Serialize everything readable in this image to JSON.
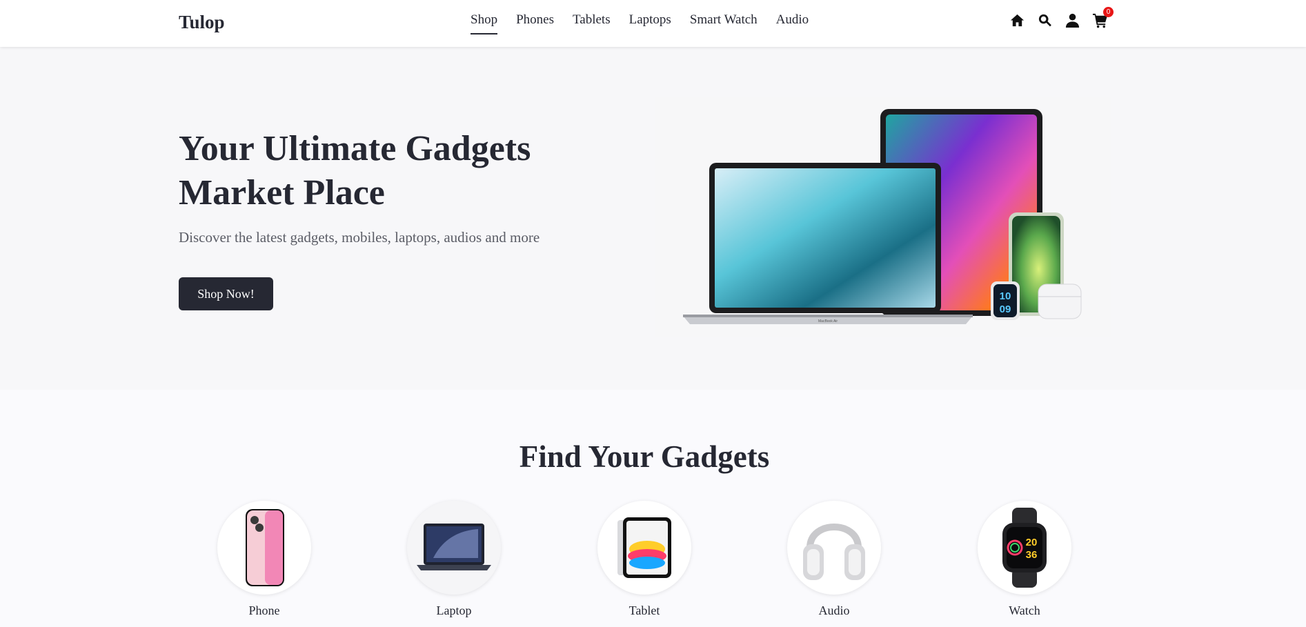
{
  "header": {
    "brand": "Tulop",
    "nav": [
      "Shop",
      "Phones",
      "Tablets",
      "Laptops",
      "Smart Watch",
      "Audio"
    ],
    "active_nav": "Shop",
    "icons": [
      "home-icon",
      "search-icon",
      "user-icon",
      "cart-icon"
    ],
    "cart_count": "0"
  },
  "hero": {
    "title_line1": "Your Ultimate Gadgets",
    "title_line2": "Market Place",
    "subtitle": "Discover the latest gadgets, mobiles, laptops, audios and more",
    "cta_label": "Shop Now!",
    "image_text": "MacBook Air",
    "watch_time_top": "10",
    "watch_time_bottom": "09"
  },
  "categories": {
    "title": "Find Your Gadgets",
    "items": [
      {
        "label": "Phone"
      },
      {
        "label": "Laptop"
      },
      {
        "label": "Tablet"
      },
      {
        "label": "Audio"
      },
      {
        "label": "Watch"
      }
    ],
    "watch_time_top": "20",
    "watch_time_bottom": "36"
  },
  "colors": {
    "primary": "#262833",
    "badge": "#e81616",
    "hero_bg": "#f7f7f9"
  }
}
